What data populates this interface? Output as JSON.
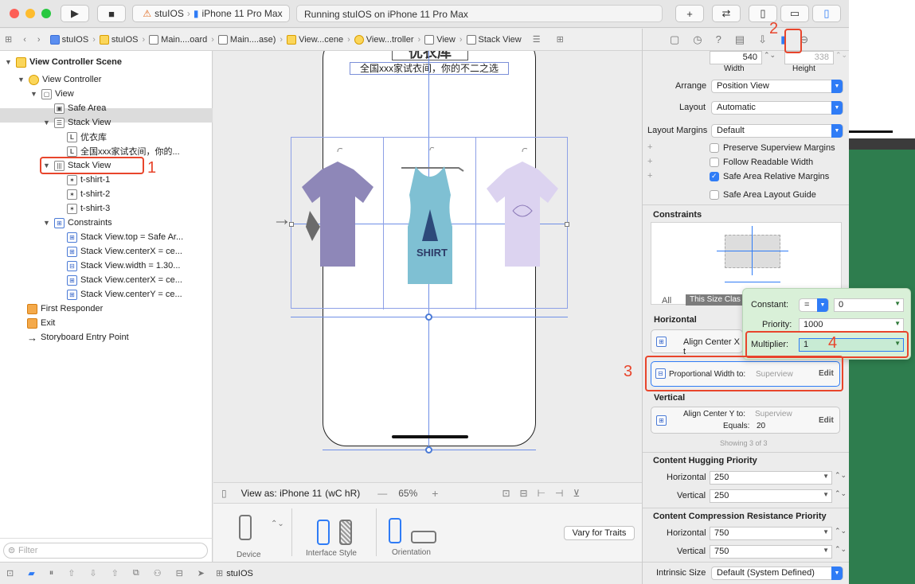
{
  "toolbar": {
    "scheme_app": "stuIOS",
    "scheme_device": "iPhone 11 Pro Max",
    "status": "Running stuIOS on iPhone 11 Pro Max"
  },
  "jumpbar": {
    "crumbs": [
      "stuIOS",
      "stuIOS",
      "Main....oard",
      "Main....ase)",
      "View...cene",
      "View...troller",
      "View",
      "Stack View"
    ]
  },
  "navigator": {
    "items": [
      {
        "label": "View Controller Scene"
      },
      {
        "label": "View Controller"
      },
      {
        "label": "View"
      },
      {
        "label": "Safe Area"
      },
      {
        "label": "Stack View"
      },
      {
        "label": "优衣库"
      },
      {
        "label": "全国xxx家试衣间，你的..."
      },
      {
        "label": "Stack View"
      },
      {
        "label": "t-shirt-1"
      },
      {
        "label": "t-shirt-2"
      },
      {
        "label": "t-shirt-3"
      },
      {
        "label": "Constraints"
      },
      {
        "label": "Stack View.top = Safe Ar..."
      },
      {
        "label": "Stack View.centerX = ce..."
      },
      {
        "label": "Stack View.width = 1.30..."
      },
      {
        "label": "Stack View.centerX = ce..."
      },
      {
        "label": "Stack View.centerY = ce..."
      },
      {
        "label": "First Responder"
      },
      {
        "label": "Exit"
      },
      {
        "label": "Storyboard Entry Point"
      }
    ],
    "filter_placeholder": "Filter"
  },
  "canvas": {
    "title_text": "优衣库",
    "subtitle_text": "全国xxx家试衣间，你的不二之选",
    "shirt2_text": "SHIRT"
  },
  "viewas": {
    "label": "View as: iPhone 11",
    "size_class": "(wC hR)",
    "zoom": "65%"
  },
  "device_panel": {
    "device": "Device",
    "interface_style": "Interface Style",
    "orientation": "Orientation",
    "vary_button": "Vary for Traits"
  },
  "bottom_bar": {
    "target": "stuIOS"
  },
  "inspector": {
    "width_value": "540",
    "height_value": "338",
    "width_label": "Width",
    "height_label": "Height",
    "arrange_label": "Arrange",
    "arrange_value": "Position View",
    "layout_label": "Layout",
    "layout_value": "Automatic",
    "margins_label": "Layout Margins",
    "margins_value": "Default",
    "cb_preserve": "Preserve Superview Margins",
    "cb_readable": "Follow Readable Width",
    "cb_safearea": "Safe Area Relative Margins",
    "cb_guide": "Safe Area Layout Guide",
    "constraints_title": "Constraints",
    "tab_all": "All",
    "tab_size": "This Size Clas",
    "horizontal_title": "Horizontal",
    "align_x": "Align Center X t",
    "prop_width": "Proportional Width to:",
    "prop_width_target": "Superview",
    "edit": "Edit",
    "vertical_title": "Vertical",
    "align_y": "Align Center Y to:",
    "align_y_target": "Superview",
    "align_y_equals": "Equals:",
    "align_y_value": "20",
    "showing": "Showing 3 of 3",
    "hugging_title": "Content Hugging Priority",
    "hug_h_label": "Horizontal",
    "hug_h_value": "250",
    "hug_v_label": "Vertical",
    "hug_v_value": "250",
    "resist_title": "Content Compression Resistance Priority",
    "res_h_label": "Horizontal",
    "res_h_value": "750",
    "res_v_label": "Vertical",
    "res_v_value": "750",
    "intrinsic_label": "Intrinsic Size",
    "intrinsic_value": "Default (System Defined)"
  },
  "popover": {
    "constant_label": "Constant:",
    "constant_relation": "=",
    "constant_value": "0",
    "priority_label": "Priority:",
    "priority_value": "1000",
    "multiplier_label": "Multiplier:",
    "multiplier_value": "1"
  },
  "annotations": {
    "n1": "1",
    "n2": "2",
    "n3": "3",
    "n4": "4"
  },
  "colors": {
    "accent": "#2f7cf6",
    "annotation": "#e8452c",
    "popover": "#d9f0d8",
    "guide": "#6f8fe6"
  }
}
